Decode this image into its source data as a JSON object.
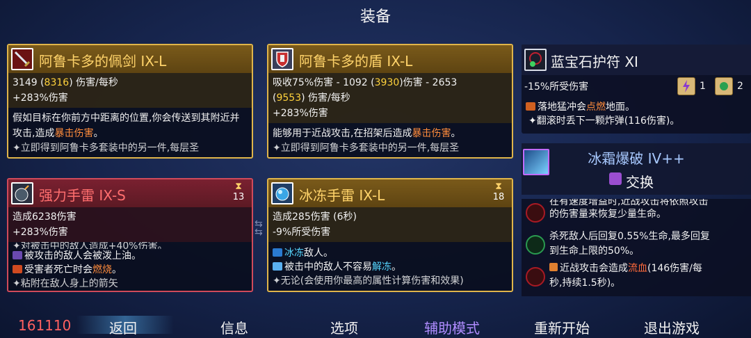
{
  "title": "装备",
  "cards": {
    "sword": {
      "name": "阿鲁卡多的佩剑 IX-L",
      "stat1_a": "3149 (",
      "stat1_b": "8316",
      "stat1_c": ") 伤害/每秒",
      "stat2": "+283%伤害",
      "desc_a": "假如目标在你前方中距离的位置,你会传送到其附近并攻击,造成",
      "desc_b": "暴击伤害",
      "desc_c": "。",
      "cut": "✦立即得到阿鲁卡多套装中的另一件,每层圣"
    },
    "shield": {
      "name": "阿鲁卡多的盾 IX-L",
      "stat1_a": "吸收75%伤害 - 1092 (",
      "stat1_b": "3930",
      "stat1_c": ")伤害 - 2653",
      "stat1_d": "(",
      "stat1_e": "9553",
      "stat1_f": ") 伤害/每秒",
      "stat2": "+283%伤害",
      "desc_a": "能够用于近战攻击,在招架后造成",
      "desc_b": "暴击伤害",
      "desc_c": "。",
      "cut": "✦立即得到阿鲁卡多套装中的另一件,每层圣"
    },
    "grenade": {
      "name": "强力手雷 IX-S",
      "timer": "13",
      "stat1": "造成6238伤害",
      "stat2": "+283%伤害",
      "cut_top": "✦对被击中的敌人造成+40%伤害。",
      "b1": "被攻击的敌人会被泼上油。",
      "b2_a": "受害者死亡时会",
      "b2_b": "燃烧",
      "b2_c": "。",
      "cut_bottom": "✦粘附在敌人身上的箭矢"
    },
    "ice": {
      "name": "冰冻手雷 IX-L",
      "timer": "18",
      "stat1": "造成285伤害 (6秒)",
      "stat2": "-9%所受伤害",
      "b1_a": "冰冻",
      "b1_b": "敌人。",
      "b2_a": "被击中的敌人不容易",
      "b2_b": "解冻",
      "b2_c": "。",
      "cut": "✦无论(会使用你最高的属性计算伤害和效果)"
    }
  },
  "amulet": {
    "name": "蓝宝石护符 XI",
    "effect": "-15%所受伤害",
    "scroll1_count": "1",
    "scroll2_count": "2",
    "b1_a": "落地猛冲会",
    "b1_b": "点燃",
    "b1_c": "地面。",
    "b2": "✦翻滚时丢下一颗炸弹(116伤害)。"
  },
  "swap": {
    "name": "冰霜爆破 IV++",
    "action": "交换"
  },
  "abilities": {
    "a1_cut": "在有速度增益时,近战攻击将依照攻击",
    "a1_end": "的伤害量来恢复少量生命。",
    "a2_l1": "杀死敌人后回复0.55%生命,最多回复",
    "a2_l2": "到生命上限的50%。",
    "a3_a": "近战攻击会造成",
    "a3_b": "流血",
    "a3_c": "(146伤害/每",
    "a3_l2": "秒,持续1.5秒)。"
  },
  "bottom": {
    "score": "161110",
    "back": "返回",
    "info": "信息",
    "options": "选项",
    "assist": "辅助模式",
    "restart": "重新开始",
    "quit": "退出游戏"
  }
}
